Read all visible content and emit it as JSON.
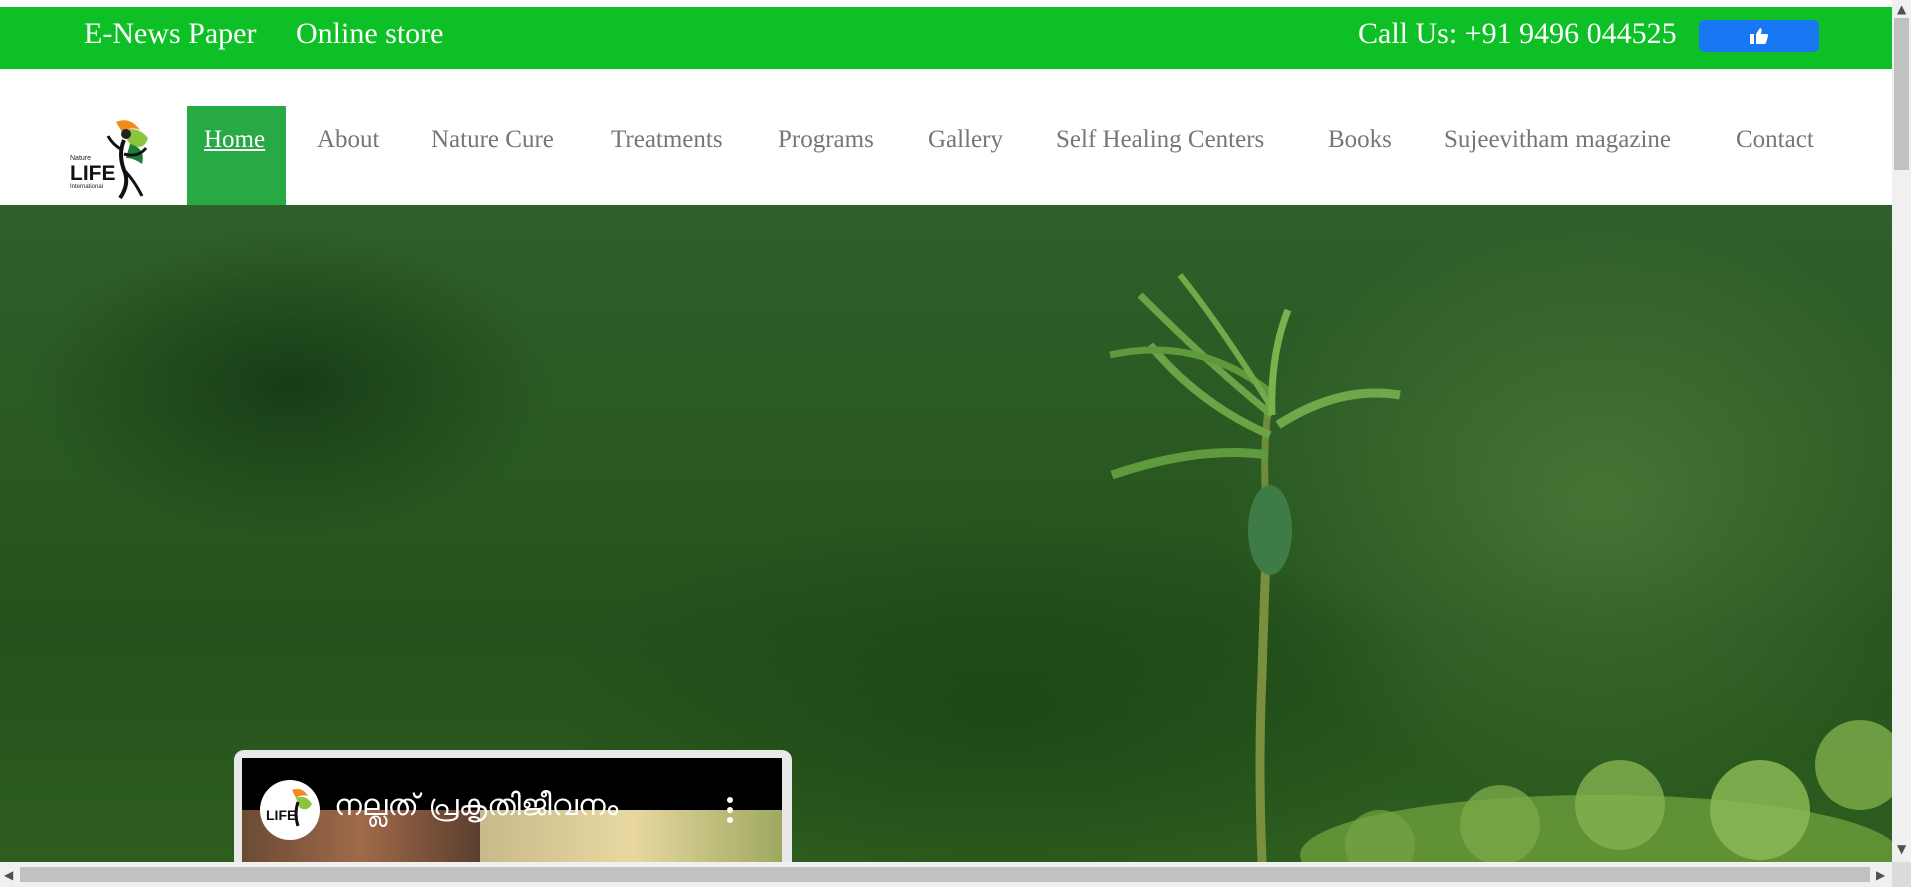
{
  "topbar": {
    "enews_label": "E-News Paper",
    "store_label": "Online store",
    "call_text": "Call Us: +91 9496 044525",
    "like_icon": "thumbs-up-icon",
    "bg_color": "#0dc026",
    "like_color": "#1877f2"
  },
  "brand": {
    "logo_top": "Nature",
    "logo_main": "LIFE",
    "logo_bottom": "International"
  },
  "nav": {
    "items": [
      {
        "label": "Home",
        "active": true
      },
      {
        "label": "About"
      },
      {
        "label": "Nature Cure"
      },
      {
        "label": "Treatments"
      },
      {
        "label": "Programs"
      },
      {
        "label": "Gallery"
      },
      {
        "label": "Self Healing Centers"
      },
      {
        "label": "Books"
      },
      {
        "label": "Sujeevitham magazine"
      },
      {
        "label": "Contact"
      }
    ],
    "active_color": "#27a944"
  },
  "video": {
    "title": "നല്ലത് പ്രകൃതിജീവനം",
    "menu_icon": "more-vertical-icon"
  }
}
